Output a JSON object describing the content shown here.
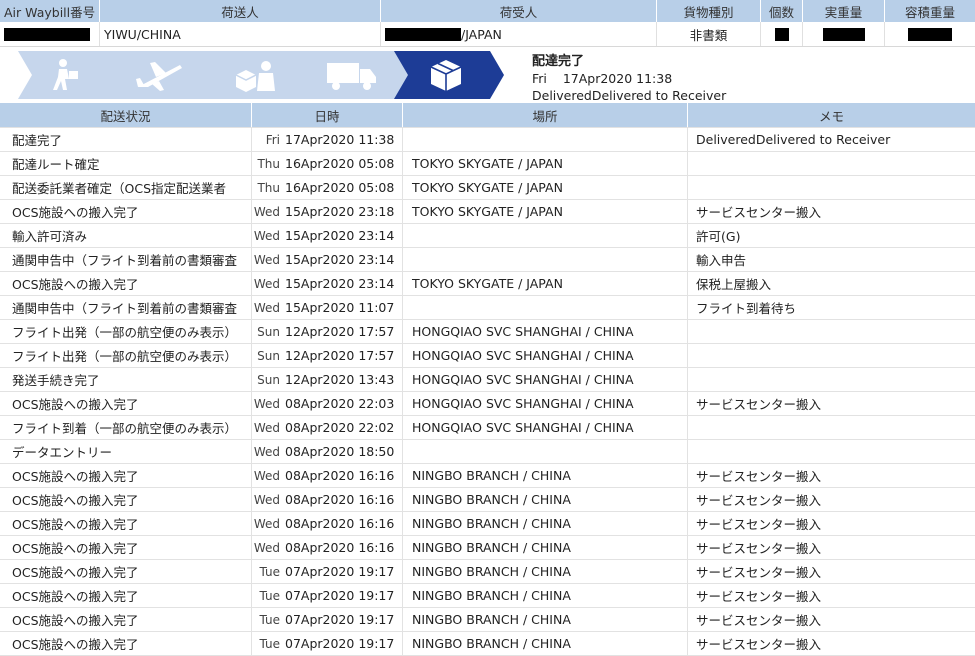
{
  "header": {
    "columns": [
      "Air Waybill番号",
      "荷送人",
      "荷受人",
      "貨物種別",
      "個数",
      "実重量",
      "容積重量"
    ],
    "shipper": "YIWU/CHINA",
    "consignee": "/JAPAN",
    "cargo_type": "非書類"
  },
  "progress": {
    "step_icons": [
      "pickup-person-icon",
      "airplane-icon",
      "customs-officer-icon",
      "delivery-truck-icon",
      "package-box-icon"
    ],
    "current_step": 5,
    "total_steps": 5,
    "status_title": "配達完了",
    "status_day": "Fri",
    "status_datetime": "17Apr2020  11:38",
    "status_detail": "DeliveredDelivered to Receiver"
  },
  "table": {
    "columns": [
      "配送状況",
      "日時",
      "場所",
      "メモ"
    ],
    "rows": [
      {
        "status": "配達完了",
        "day": "Fri",
        "datetime": "17Apr2020  11:38",
        "location": "",
        "memo": "DeliveredDelivered to Receiver"
      },
      {
        "status": "配達ルート確定",
        "day": "Thu",
        "datetime": "16Apr2020  05:08",
        "location": "TOKYO SKYGATE / JAPAN",
        "memo": ""
      },
      {
        "status": "配送委託業者確定（OCS指定配送業者",
        "day": "Thu",
        "datetime": "16Apr2020  05:08",
        "location": "TOKYO SKYGATE / JAPAN",
        "memo": ""
      },
      {
        "status": "OCS施設への搬入完了",
        "day": "Wed",
        "datetime": "15Apr2020  23:18",
        "location": "TOKYO SKYGATE / JAPAN",
        "memo": "サービスセンター搬入"
      },
      {
        "status": "輸入許可済み",
        "day": "Wed",
        "datetime": "15Apr2020  23:14",
        "location": "",
        "memo": "許可(G)"
      },
      {
        "status": "通関申告中（フライト到着前の書類審査",
        "day": "Wed",
        "datetime": "15Apr2020  23:14",
        "location": "",
        "memo": "輸入申告"
      },
      {
        "status": "OCS施設への搬入完了",
        "day": "Wed",
        "datetime": "15Apr2020  23:14",
        "location": "TOKYO SKYGATE / JAPAN",
        "memo": "保税上屋搬入"
      },
      {
        "status": "通関申告中（フライト到着前の書類審査",
        "day": "Wed",
        "datetime": "15Apr2020  11:07",
        "location": "",
        "memo": "フライト到着待ち"
      },
      {
        "status": "フライト出発（一部の航空便のみ表示）",
        "day": "Sun",
        "datetime": "12Apr2020  17:57",
        "location": "HONGQIAO SVC SHANGHAI / CHINA",
        "memo": ""
      },
      {
        "status": "フライト出発（一部の航空便のみ表示）",
        "day": "Sun",
        "datetime": "12Apr2020  17:57",
        "location": "HONGQIAO SVC SHANGHAI / CHINA",
        "memo": ""
      },
      {
        "status": "発送手続き完了",
        "day": "Sun",
        "datetime": "12Apr2020  13:43",
        "location": "HONGQIAO SVC SHANGHAI / CHINA",
        "memo": ""
      },
      {
        "status": "OCS施設への搬入完了",
        "day": "Wed",
        "datetime": "08Apr2020  22:03",
        "location": "HONGQIAO SVC SHANGHAI / CHINA",
        "memo": "サービスセンター搬入"
      },
      {
        "status": "フライト到着（一部の航空便のみ表示）",
        "day": "Wed",
        "datetime": "08Apr2020  22:02",
        "location": "HONGQIAO SVC SHANGHAI / CHINA",
        "memo": ""
      },
      {
        "status": "データエントリー",
        "day": "Wed",
        "datetime": "08Apr2020  18:50",
        "location": "",
        "memo": ""
      },
      {
        "status": "OCS施設への搬入完了",
        "day": "Wed",
        "datetime": "08Apr2020  16:16",
        "location": "NINGBO BRANCH / CHINA",
        "memo": "サービスセンター搬入"
      },
      {
        "status": "OCS施設への搬入完了",
        "day": "Wed",
        "datetime": "08Apr2020  16:16",
        "location": "NINGBO BRANCH / CHINA",
        "memo": "サービスセンター搬入"
      },
      {
        "status": "OCS施設への搬入完了",
        "day": "Wed",
        "datetime": "08Apr2020  16:16",
        "location": "NINGBO BRANCH / CHINA",
        "memo": "サービスセンター搬入"
      },
      {
        "status": "OCS施設への搬入完了",
        "day": "Wed",
        "datetime": "08Apr2020  16:16",
        "location": "NINGBO BRANCH / CHINA",
        "memo": "サービスセンター搬入"
      },
      {
        "status": "OCS施設への搬入完了",
        "day": "Tue",
        "datetime": "07Apr2020  19:17",
        "location": "NINGBO BRANCH / CHINA",
        "memo": "サービスセンター搬入"
      },
      {
        "status": "OCS施設への搬入完了",
        "day": "Tue",
        "datetime": "07Apr2020  19:17",
        "location": "NINGBO BRANCH / CHINA",
        "memo": "サービスセンター搬入"
      },
      {
        "status": "OCS施設への搬入完了",
        "day": "Tue",
        "datetime": "07Apr2020  19:17",
        "location": "NINGBO BRANCH / CHINA",
        "memo": "サービスセンター搬入"
      },
      {
        "status": "OCS施設への搬入完了",
        "day": "Tue",
        "datetime": "07Apr2020  19:17",
        "location": "NINGBO BRANCH / CHINA",
        "memo": "サービスセンター搬入"
      }
    ]
  },
  "colors": {
    "header_bg": "#b8cfe8",
    "step_inactive": "#c6d6ec",
    "step_active": "#1d3c96"
  }
}
